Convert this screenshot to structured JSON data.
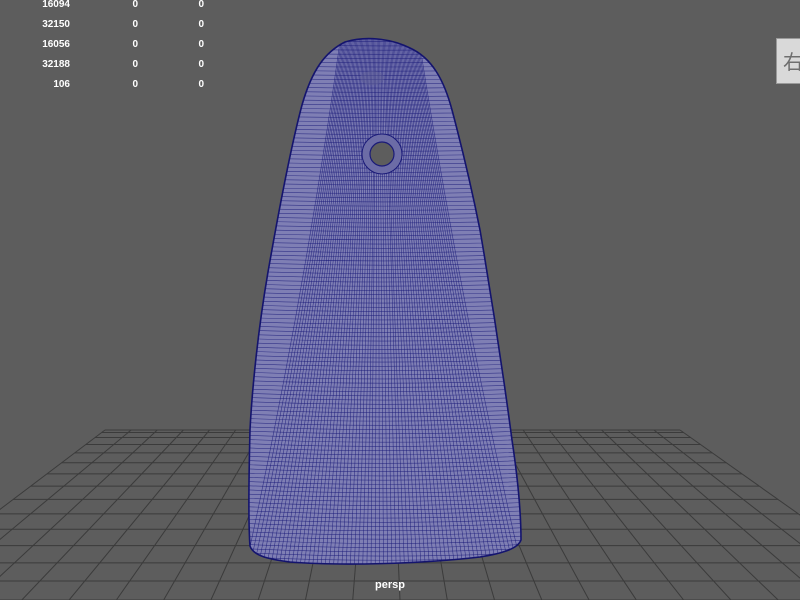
{
  "viewport": {
    "camera_name": "persp",
    "background_color": "#5d5d5d",
    "grid_color": "#3b3b3b",
    "mesh_fill_color": "#7f7fb4",
    "mesh_wire_color": "#1a1a78"
  },
  "hud": {
    "rows": [
      {
        "v1": "16094",
        "v2": "0",
        "v3": "0"
      },
      {
        "v1": "32150",
        "v2": "0",
        "v3": "0"
      },
      {
        "v1": "16056",
        "v2": "0",
        "v3": "0"
      },
      {
        "v1": "32188",
        "v2": "0",
        "v3": "0"
      },
      {
        "v1": "106",
        "v2": "0",
        "v3": "0"
      }
    ]
  },
  "corner_widget": {
    "glyph": "右"
  }
}
